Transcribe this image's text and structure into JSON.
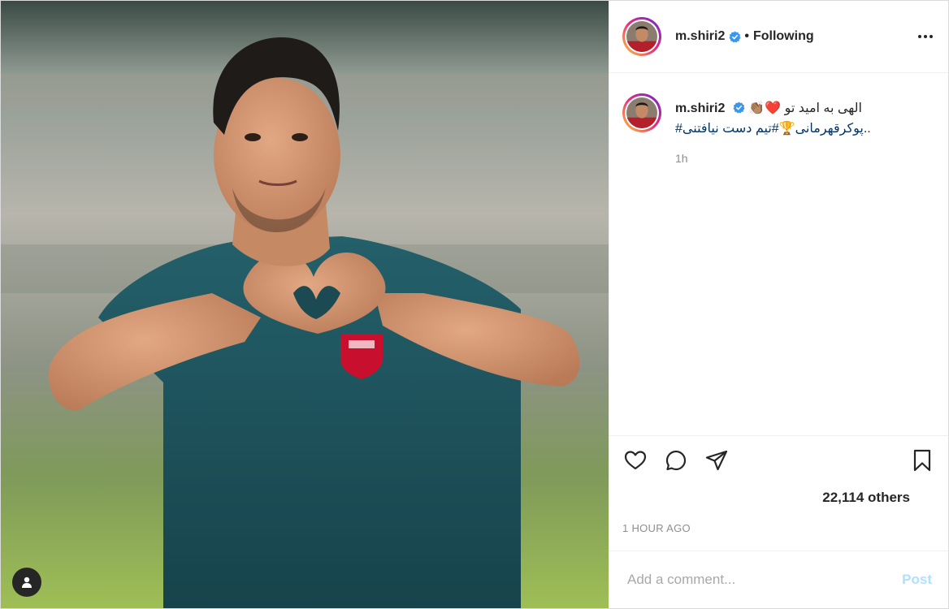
{
  "header": {
    "username": "m.shiri2",
    "separator": "•",
    "follow_state": "Following",
    "verified_icon": "verified-badge-icon",
    "more_icon": "more-options-icon"
  },
  "caption": {
    "username": "m.shiri2",
    "line1_text": "الهی به امید تو",
    "line1_emojis": "👏🏽❤️",
    "hashtag1": "#پوکرقهرمانی",
    "trophy_emoji": "🏆",
    "hashtag2": "#تیم دست نیافتنی",
    "trailing": "..",
    "time": "1h"
  },
  "actions": {
    "like_icon": "heart-icon",
    "comment_icon": "comment-icon",
    "share_icon": "share-icon",
    "save_icon": "bookmark-icon"
  },
  "likes": {
    "text": "22,114 others"
  },
  "post_date": "1 HOUR AGO",
  "comment_box": {
    "placeholder": "Add a comment...",
    "post_label": "Post"
  },
  "media": {
    "tag_icon": "user-tag-icon"
  },
  "colors": {
    "text": "#262626",
    "muted": "#8e8e8e",
    "hashtag": "#00376b",
    "post_disabled": "#b2dffc",
    "verified": "#3897f0",
    "jersey": "#1f5560"
  }
}
